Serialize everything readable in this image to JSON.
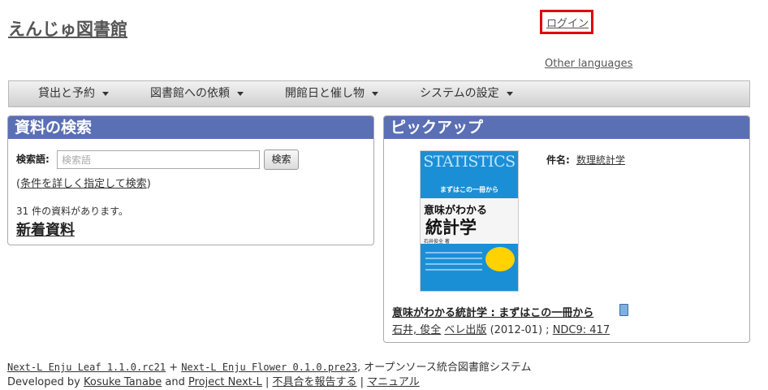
{
  "header": {
    "site_title": "えんじゅ図書館",
    "login_label": "ログイン",
    "other_languages": "Other languages"
  },
  "nav": {
    "items": [
      "貸出と予約",
      "図書館への依頼",
      "開館日と催し物",
      "システムの設定"
    ]
  },
  "search": {
    "heading": "資料の検索",
    "label": "検索語:",
    "placeholder": "検索語",
    "button": "検索",
    "adv_open": "(",
    "adv_link": "条件を詳しく指定して検索",
    "adv_close": ")",
    "count_text": "31 件の資料があります。",
    "new_items": "新着資料"
  },
  "pickup": {
    "heading": "ピックアップ",
    "cover": {
      "top_text": "STATISTICS",
      "sub_text": "まずはこの一冊から",
      "title_line1": "意味がわかる",
      "title_line2": "統計学",
      "author_text": "石井俊全 著"
    },
    "subject_label": "件名:",
    "subject_value": "数理統計学",
    "book_title": "意味がわかる統計学 : まずはこの一冊から",
    "author": "石井, 俊全",
    "publisher": "ベレ出版",
    "date": "(2012-01) ;",
    "ndc": "NDC9: 417"
  },
  "footer": {
    "leaf": "Next-L Enju Leaf 1.1.0.rc21",
    "plus": " + ",
    "flower": "Next-L Enju Flower 0.1.0.pre23",
    "system_text": ", オープンソース統合図書館システム",
    "developed_by": "Developed by ",
    "dev1": "Kosuke Tanabe",
    "and": " and ",
    "dev2": "Project Next-L",
    "sep": " | ",
    "report": "不具合を報告する",
    "manual": "マニュアル"
  },
  "colors": {
    "panel_header": "#5a6fb4",
    "highlight_border": "#e00000",
    "cover_blue": "#1b8fd6"
  }
}
